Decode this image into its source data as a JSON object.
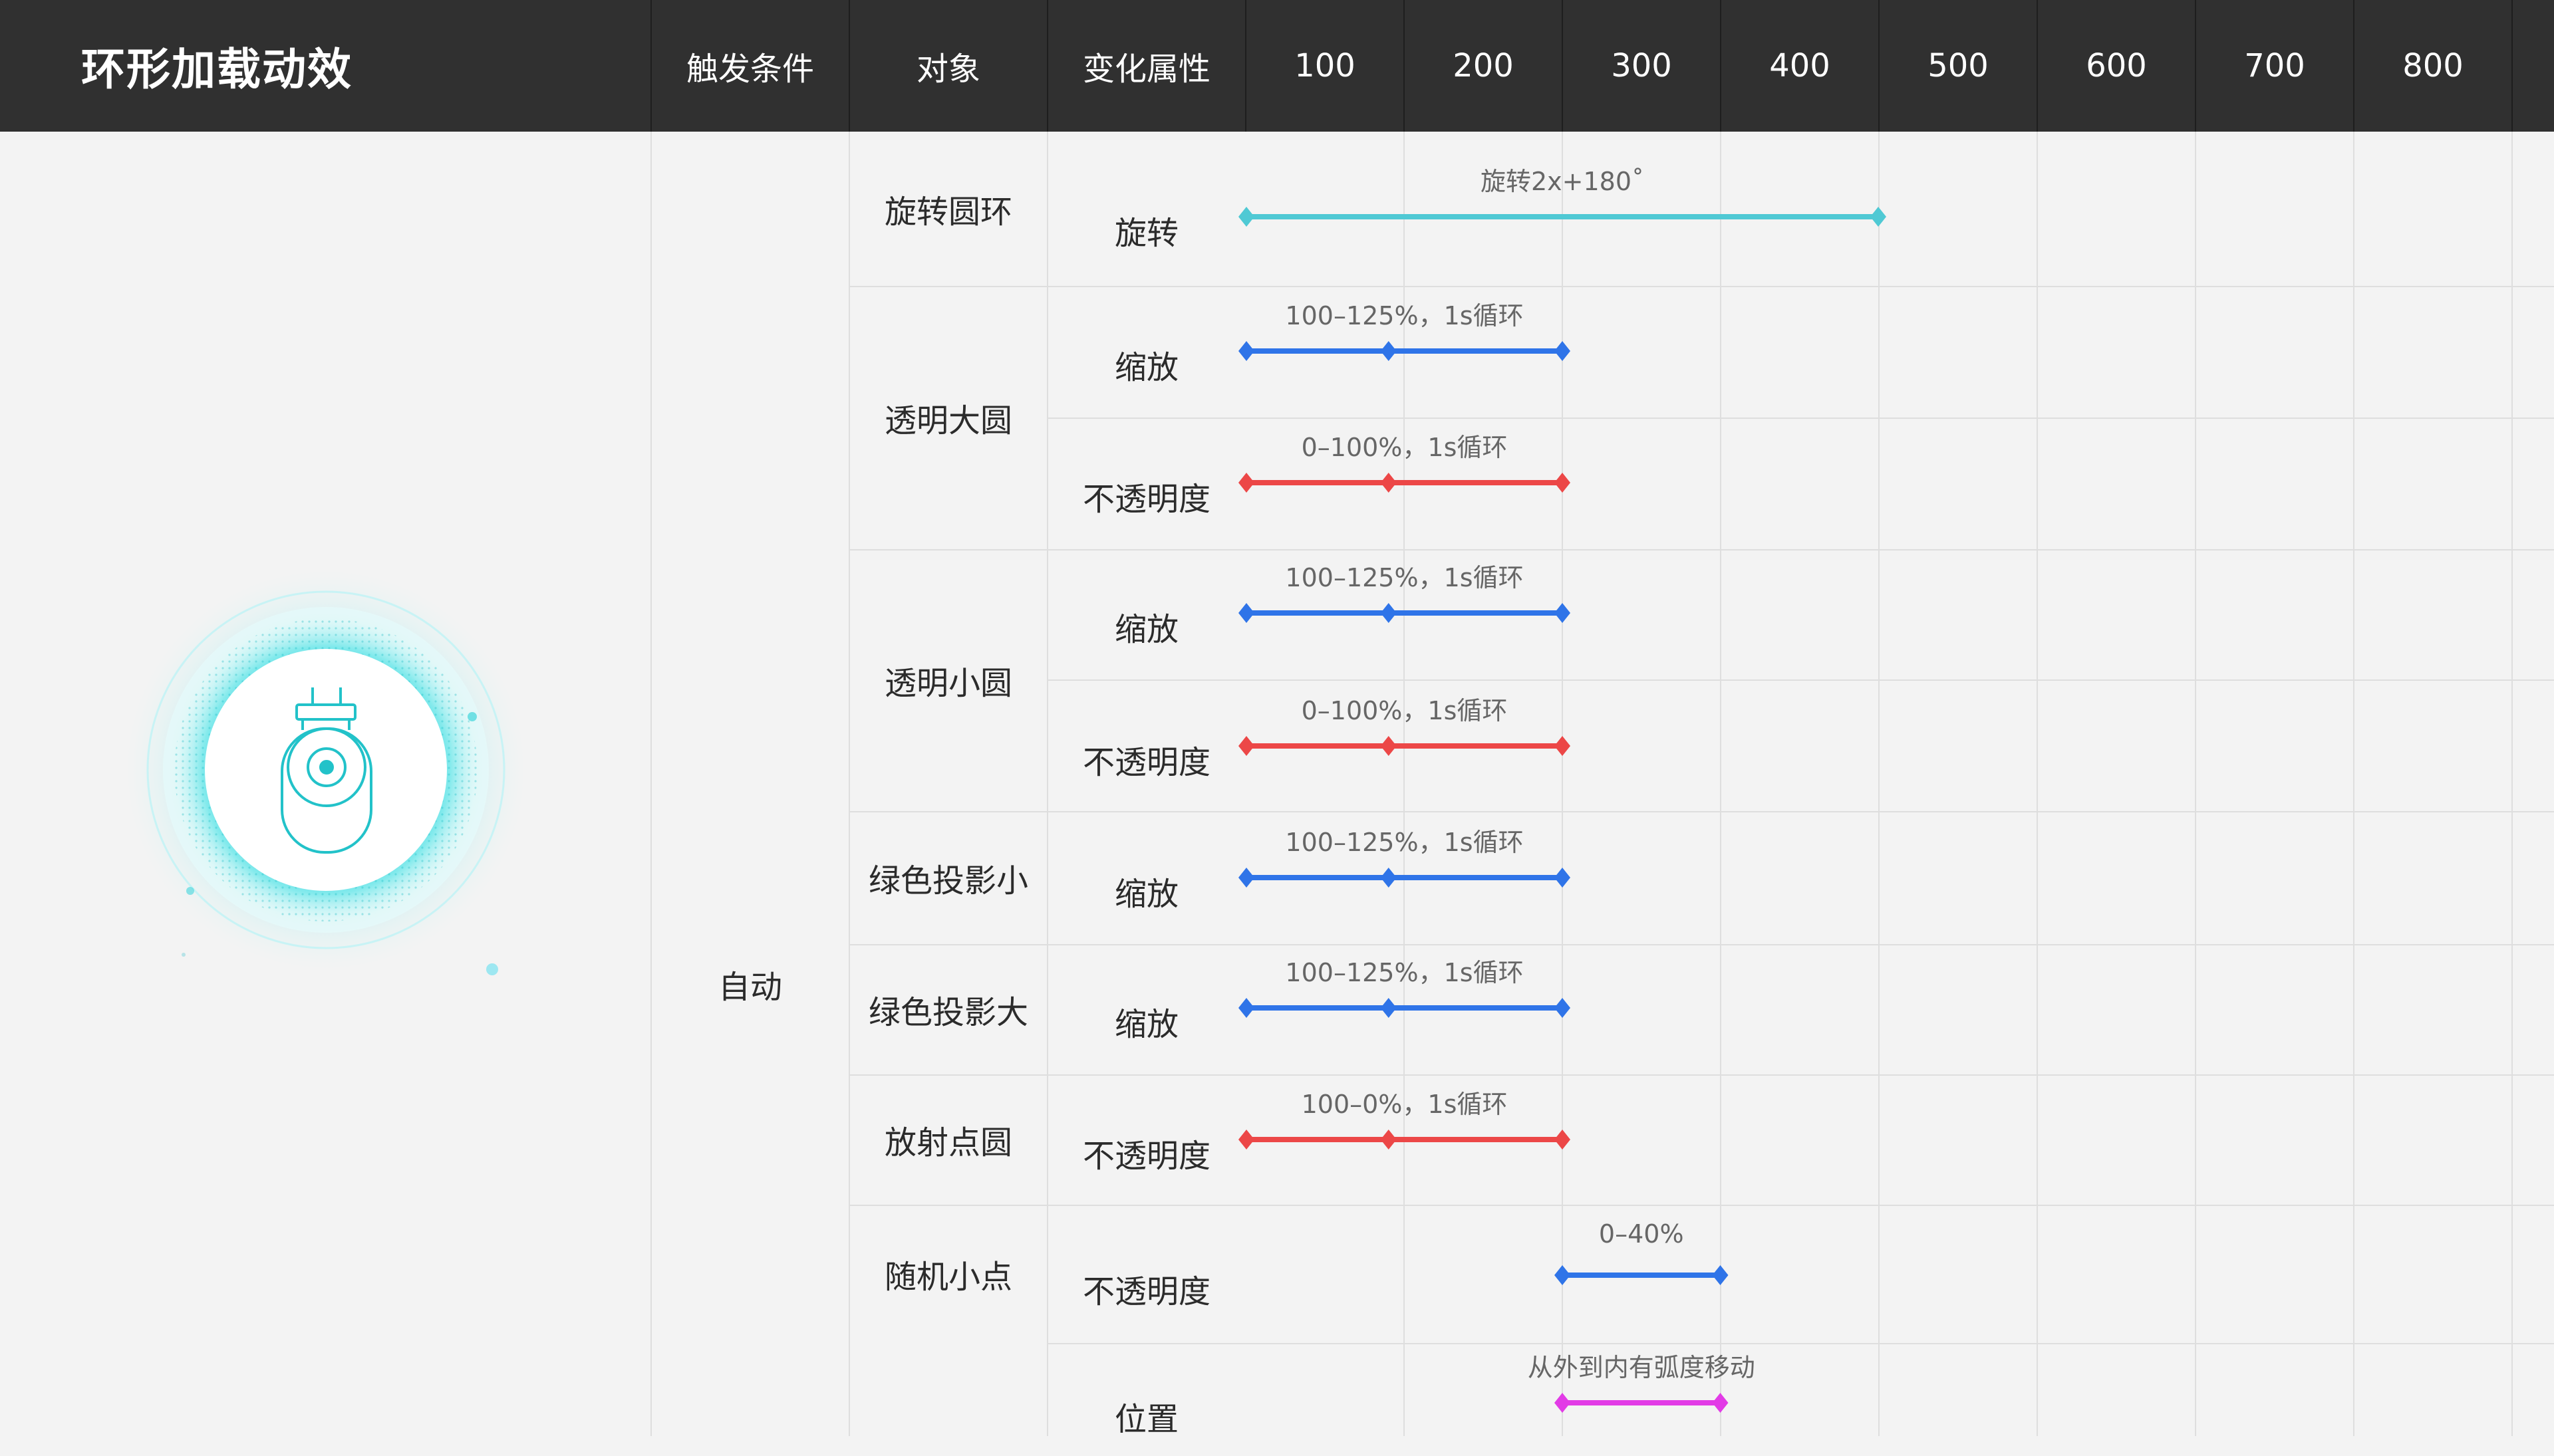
{
  "header": {
    "title": "环形加载动效",
    "col_trigger": "触发条件",
    "col_object": "对象",
    "col_property": "变化属性",
    "ticks": [
      "100",
      "200",
      "300",
      "400",
      "500",
      "600",
      "700",
      "800"
    ]
  },
  "trigger": "自动",
  "objects": [
    {
      "name": "旋转圆环"
    },
    {
      "name": "透明大圆"
    },
    {
      "name": "透明小圆"
    },
    {
      "name": "绿色投影小"
    },
    {
      "name": "绿色投影大"
    },
    {
      "name": "放射点圆"
    },
    {
      "name": "随机小点"
    }
  ],
  "tracks": [
    {
      "property": "旋转",
      "label": "旋转2x+180˚",
      "start": 0,
      "end": 400,
      "keys": [
        0,
        400
      ],
      "color": "#4fc9d4"
    },
    {
      "property": "缩放",
      "label": "100–125%，1s循环",
      "start": 0,
      "end": 200,
      "keys": [
        0,
        90,
        200
      ],
      "color": "#2f74e8"
    },
    {
      "property": "不透明度",
      "label": "0–100%，1s循环",
      "start": 0,
      "end": 200,
      "keys": [
        0,
        90,
        200
      ],
      "color": "#ec4747"
    },
    {
      "property": "缩放",
      "label": "100–125%，1s循环",
      "start": 0,
      "end": 200,
      "keys": [
        0,
        90,
        200
      ],
      "color": "#2f74e8"
    },
    {
      "property": "不透明度",
      "label": "0–100%，1s循环",
      "start": 0,
      "end": 200,
      "keys": [
        0,
        90,
        200
      ],
      "color": "#ec4747"
    },
    {
      "property": "缩放",
      "label": "100–125%，1s循环",
      "start": 0,
      "end": 200,
      "keys": [
        0,
        90,
        200
      ],
      "color": "#2f74e8"
    },
    {
      "property": "缩放",
      "label": "100–125%，1s循环",
      "start": 0,
      "end": 200,
      "keys": [
        0,
        90,
        200
      ],
      "color": "#2f74e8"
    },
    {
      "property": "不透明度",
      "label": "100–0%，1s循环",
      "start": 0,
      "end": 200,
      "keys": [
        0,
        90,
        200
      ],
      "color": "#ec4747"
    },
    {
      "property": "不透明度",
      "label": "0–40%",
      "start": 200,
      "end": 300,
      "keys": [
        200,
        300
      ],
      "color": "#2f74e8"
    },
    {
      "property": "位置",
      "label": "从外到内有弧度移动",
      "start": 200,
      "end": 300,
      "keys": [
        200,
        300
      ],
      "color": "#e23be6"
    }
  ],
  "preview": {
    "icon": "plug-camera-icon",
    "accent": "#19d6dc",
    "ring_color": "#9ff0f2",
    "stroke_color": "#22c2c9"
  }
}
